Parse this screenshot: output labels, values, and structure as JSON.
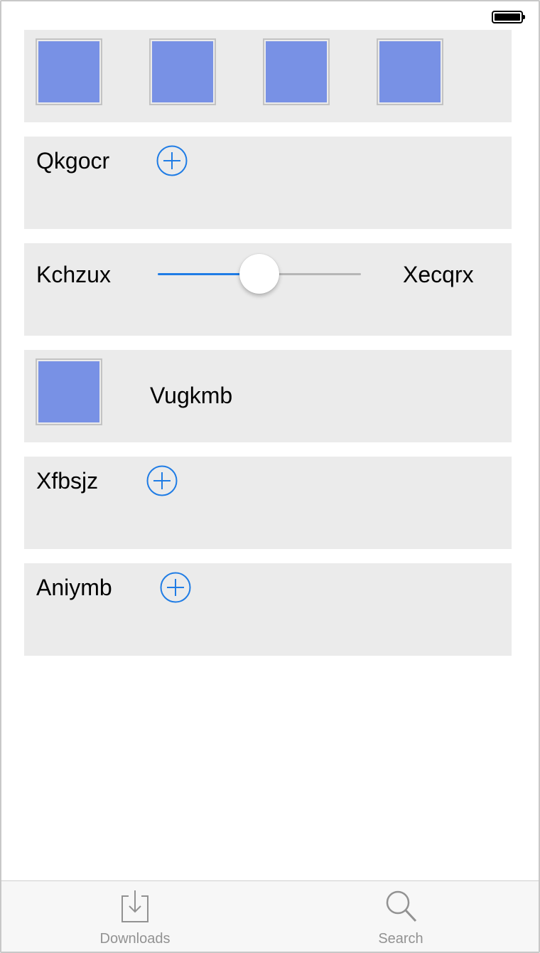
{
  "status_bar": {
    "battery_icon": "battery-full-icon"
  },
  "rows": {
    "gallery": {
      "images": [
        "image-placeholder",
        "image-placeholder",
        "image-placeholder",
        "image-placeholder"
      ]
    },
    "row2": {
      "label": "Qkgocr",
      "button_icon": "add-circle-icon"
    },
    "slider_row": {
      "min_label": "Kchzux",
      "max_label": "Xecqrx",
      "value_fraction": 0.5
    },
    "image_row": {
      "label": "Vugkmb",
      "image": "image-placeholder"
    },
    "row5": {
      "label": "Xfbsjz",
      "button_icon": "add-circle-icon"
    },
    "row6": {
      "label": "Aniymb",
      "button_icon": "add-circle-icon"
    }
  },
  "tabbar": {
    "tabs": [
      {
        "label": "Downloads",
        "icon": "download-tray-icon"
      },
      {
        "label": "Search",
        "icon": "magnifier-icon"
      }
    ]
  },
  "colors": {
    "accent": "#1f7ce5",
    "row_background": "#ebebeb",
    "image_fill": "#7891e5",
    "tab_label": "#929292"
  }
}
